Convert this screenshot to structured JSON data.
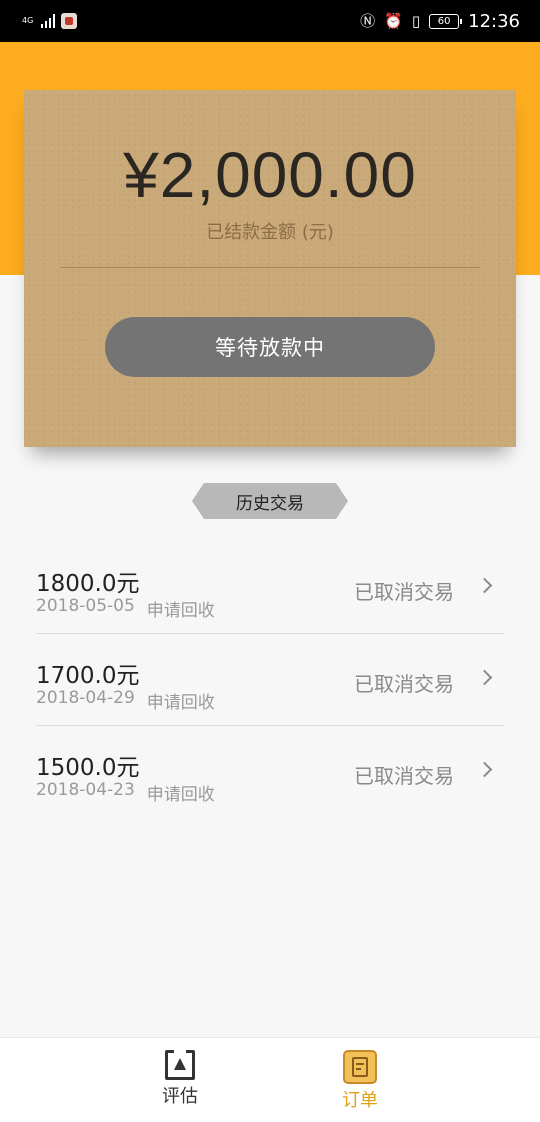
{
  "status_bar": {
    "network": "4G",
    "battery": "60",
    "time": "12:36",
    "icons": [
      "signal-icon",
      "app-notification-icon",
      "nfc-icon",
      "alarm-icon",
      "vibrate-icon",
      "battery-icon"
    ]
  },
  "summary": {
    "amount": "¥2,000.00",
    "label": "已结款金额 (元)",
    "status_button": "等待放款中"
  },
  "history": {
    "title": "历史交易",
    "items": [
      {
        "amount": "1800.0元",
        "date": "2018-05-05",
        "type": "申请回收",
        "status": "已取消交易"
      },
      {
        "amount": "1700.0元",
        "date": "2018-04-29",
        "type": "申请回收",
        "status": "已取消交易"
      },
      {
        "amount": "1500.0元",
        "date": "2018-04-23",
        "type": "申请回收",
        "status": "已取消交易"
      }
    ]
  },
  "nav": {
    "items": [
      {
        "label": "评估",
        "icon": "assess-icon",
        "active": false
      },
      {
        "label": "订单",
        "icon": "orders-icon",
        "active": true
      }
    ]
  },
  "colors": {
    "header": "#fcac1e",
    "card": "#caa978",
    "button": "#747474",
    "active_nav": "#e2a115"
  }
}
